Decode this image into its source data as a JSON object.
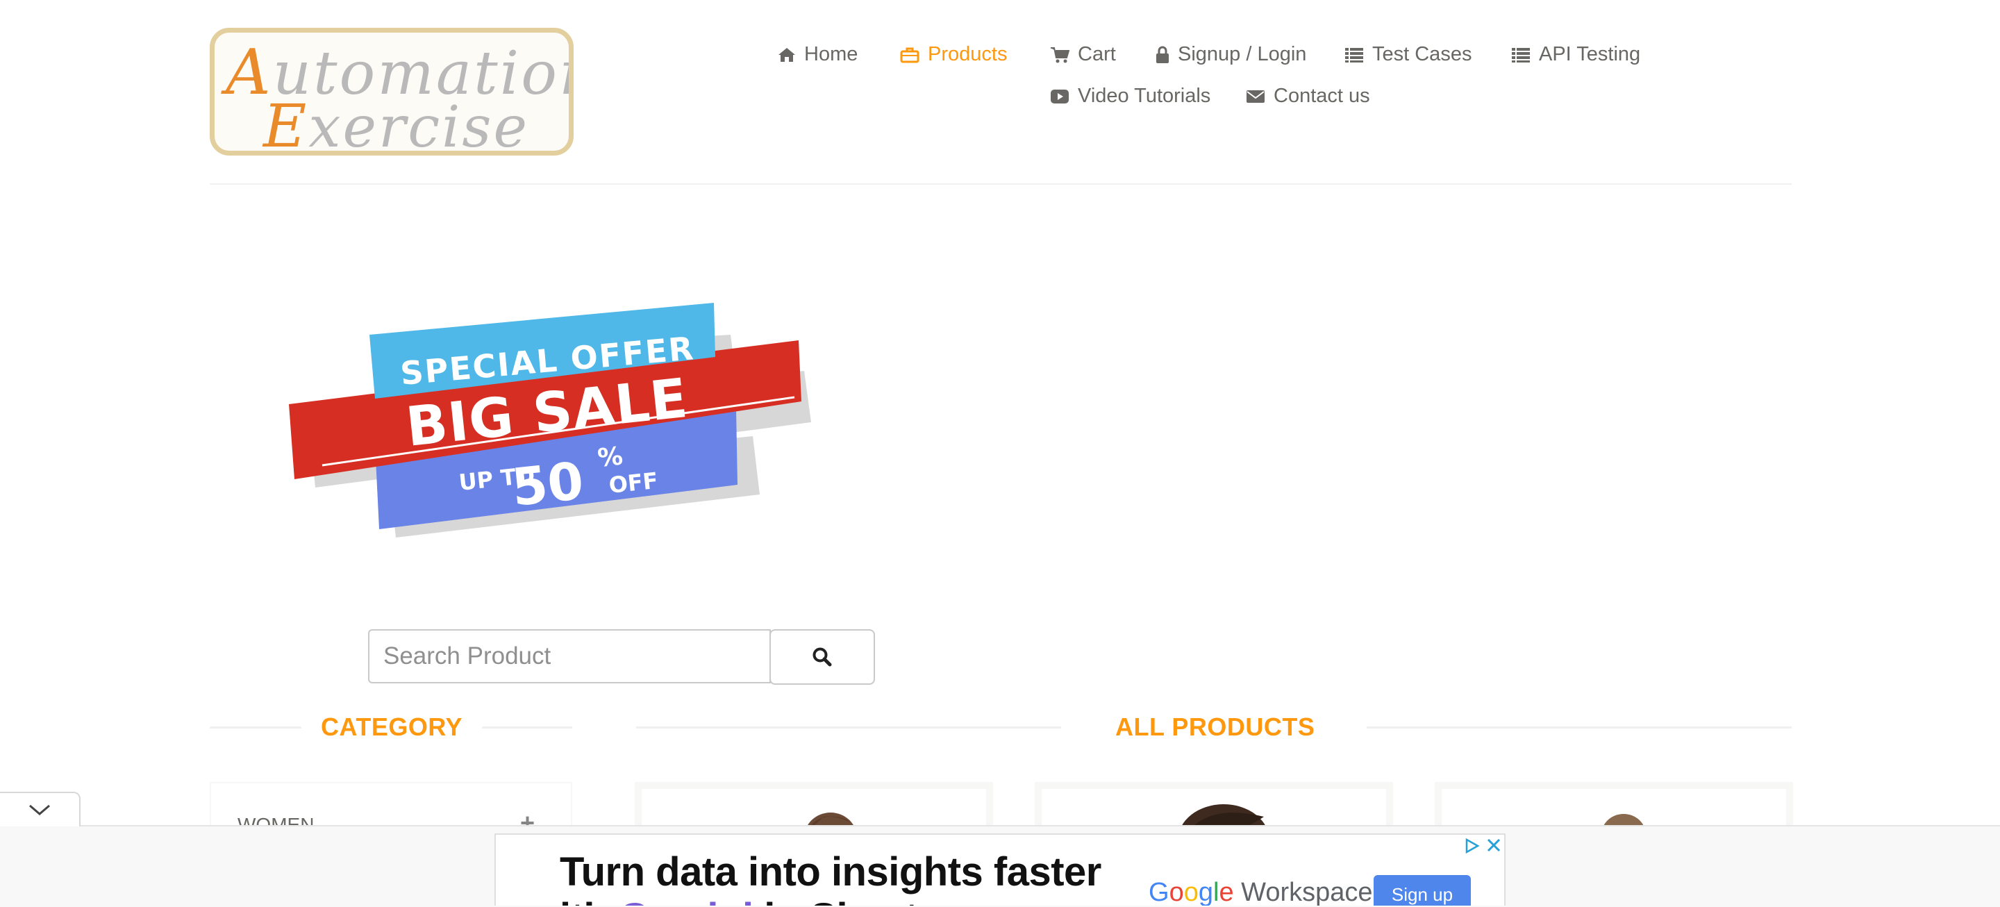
{
  "logo": {
    "line1_initial": "A",
    "line1_rest": "utomation",
    "line2_initial": "E",
    "line2_rest": "xercise"
  },
  "nav": {
    "items": [
      {
        "label": "Home",
        "icon": "home-icon"
      },
      {
        "label": "Products",
        "icon": "briefcase-icon",
        "active": true
      },
      {
        "label": "Cart",
        "icon": "cart-icon"
      },
      {
        "label": "Signup / Login",
        "icon": "lock-icon"
      },
      {
        "label": "Test Cases",
        "icon": "list-icon"
      },
      {
        "label": "API Testing",
        "icon": "list-icon"
      },
      {
        "label": "Video Tutorials",
        "icon": "youtube-play-icon"
      },
      {
        "label": "Contact us",
        "icon": "envelope-icon"
      }
    ],
    "active_color": "#fe980f",
    "text_color": "#696763"
  },
  "banner": {
    "line1": "SPECIAL OFFER",
    "line2": "BIG SALE",
    "up_to": "UP TO",
    "percent_value": "50",
    "percent_sign": "%",
    "off": "OFF",
    "colors": {
      "top": "#4fb8e8",
      "middle": "#d62e23",
      "bottom": "#6a83e6"
    }
  },
  "search": {
    "placeholder": "Search Product",
    "value": "",
    "button_icon": "search-icon"
  },
  "sections": {
    "category_title": "CATEGORY",
    "products_title": "ALL PRODUCTS",
    "accent": "#fe980f"
  },
  "category": {
    "items": [
      {
        "label": "WOMEN",
        "toggle": "+"
      }
    ]
  },
  "ad": {
    "headline": "Turn data into insights faster",
    "line2_start": "ith ",
    "line2_mid": "Gemini",
    "line2_end": " in Sheets",
    "brand": {
      "g1": "G",
      "g2": "o",
      "g3": "o",
      "g4": "g",
      "g5": "l",
      "g6": "e",
      "product": "Workspace"
    },
    "cta": "Sign up",
    "info_icon": "adchoices-icon",
    "close_icon": "close-icon"
  },
  "collapse_icon": "chevron-down-icon"
}
